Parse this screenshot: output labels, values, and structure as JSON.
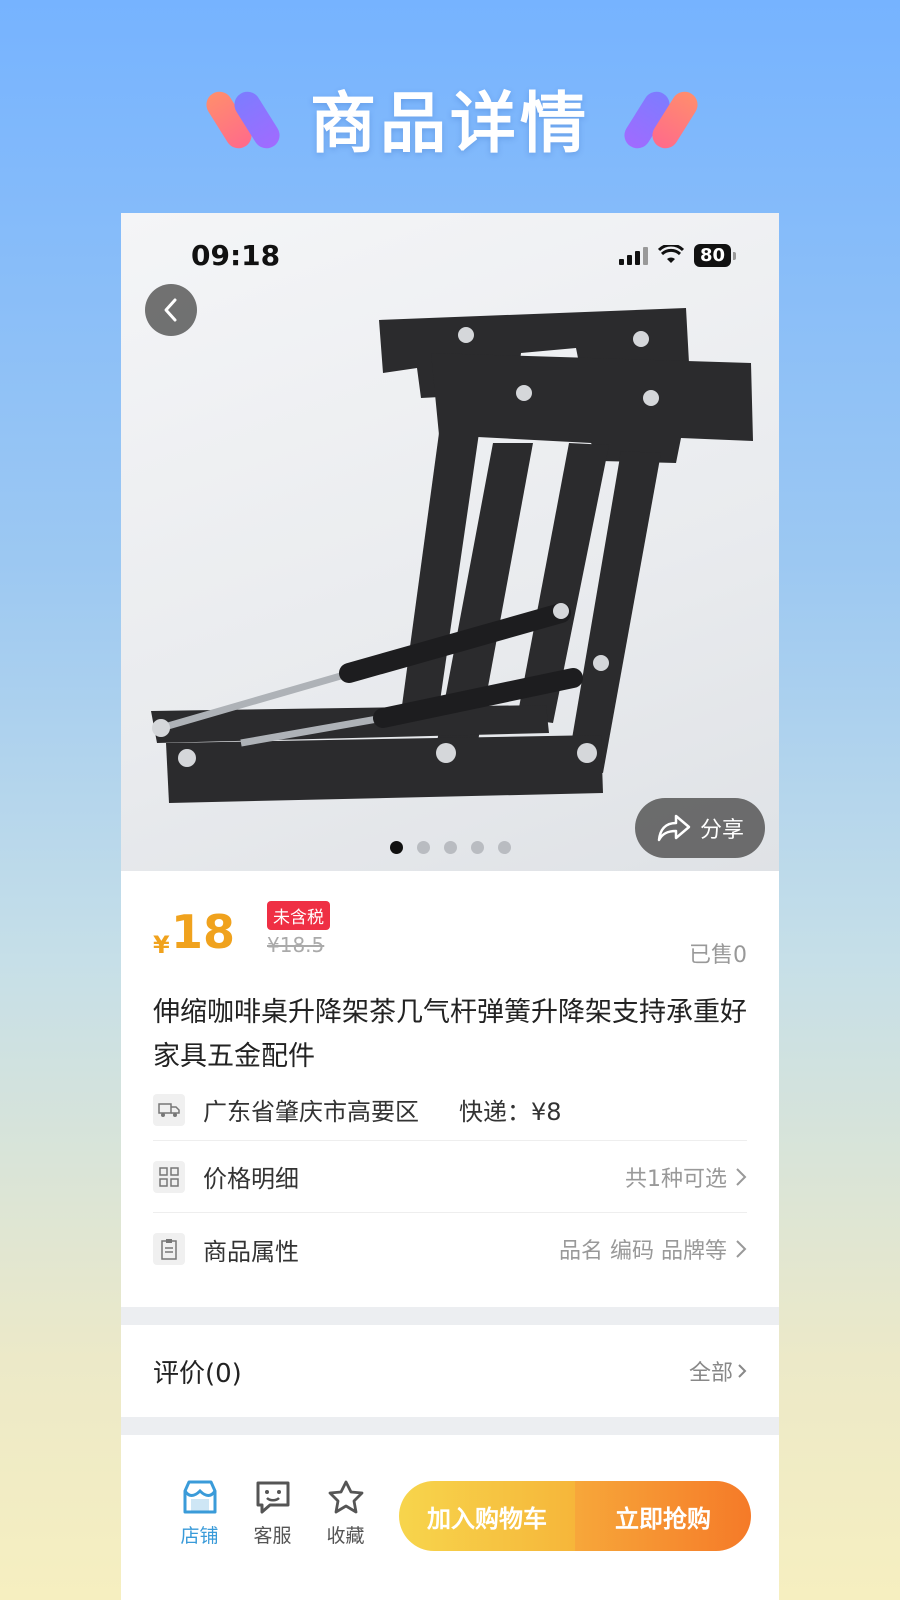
{
  "banner": {
    "title": "商品详情"
  },
  "status_bar": {
    "time": "09:18",
    "battery": "80"
  },
  "share": {
    "label": "分享"
  },
  "gallery": {
    "dot_count": 5,
    "active_index": 0
  },
  "product": {
    "currency": "¥",
    "price": "18",
    "tax_badge": "未含税",
    "original_price": "¥18.5",
    "sold": "已售0",
    "title": "伸缩咖啡桌升降架茶几气杆弹簧升降架支持承重好家具五金配件"
  },
  "rows": {
    "shipping": {
      "location": "广东省肇庆市高要区",
      "express": "快递：¥8"
    },
    "price_detail": {
      "label": "价格明细",
      "value": "共1种可选"
    },
    "attributes": {
      "label": "商品属性",
      "value": "品名 编码 品牌等"
    }
  },
  "reviews": {
    "title": "评价(0)",
    "all": "全部"
  },
  "bottom_bar": {
    "tabs": [
      {
        "label": "店铺",
        "icon": "store-icon"
      },
      {
        "label": "客服",
        "icon": "chat-icon"
      },
      {
        "label": "收藏",
        "icon": "star-icon"
      }
    ],
    "add_to_cart": "加入购物车",
    "buy_now": "立即抢购"
  },
  "colors": {
    "price": "#f0a21d",
    "tax_badge": "#ef2f44",
    "active_tab": "#3a9bd9"
  }
}
